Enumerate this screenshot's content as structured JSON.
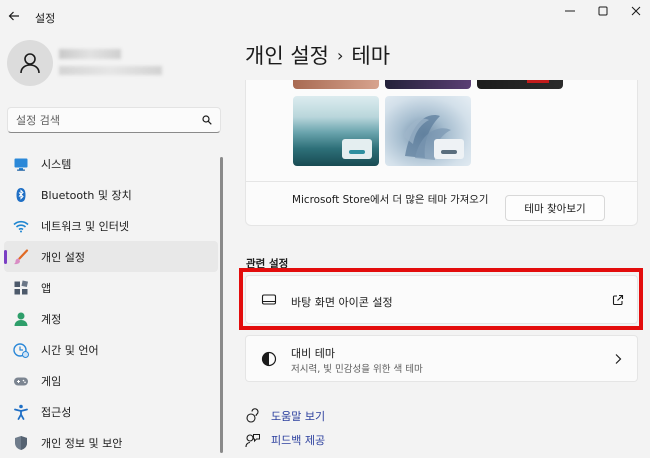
{
  "window": {
    "title": "설정"
  },
  "search": {
    "placeholder": "설정 검색"
  },
  "sidebar": {
    "items": [
      {
        "label": "시스템"
      },
      {
        "label": "Bluetooth 및 장치"
      },
      {
        "label": "네트워크 및 인터넷"
      },
      {
        "label": "개인 설정"
      },
      {
        "label": "앱"
      },
      {
        "label": "계정"
      },
      {
        "label": "시간 및 언어"
      },
      {
        "label": "게임"
      },
      {
        "label": "접근성"
      },
      {
        "label": "개인 정보 및 보안"
      }
    ],
    "selected_index": 3
  },
  "header": {
    "parent": "개인 설정",
    "separator": "›",
    "current": "테마"
  },
  "themes": {
    "store_text": "Microsoft Store에서 더 많은 테마 가져오기",
    "browse_label": "테마 찾아보기"
  },
  "related": {
    "title": "관련 설정",
    "desktop_icons": {
      "title": "바탕 화면 아이콘 설정"
    },
    "contrast": {
      "title": "대비 테마",
      "subtitle": "저시력, 빛 민감성을 위한 색 테마"
    }
  },
  "links": {
    "help": "도움말 보기",
    "feedback": "피드백 제공"
  },
  "colors": {
    "accent": "#7b3fc4",
    "highlight": "#e30c0c",
    "link": "#2b3f9e"
  }
}
